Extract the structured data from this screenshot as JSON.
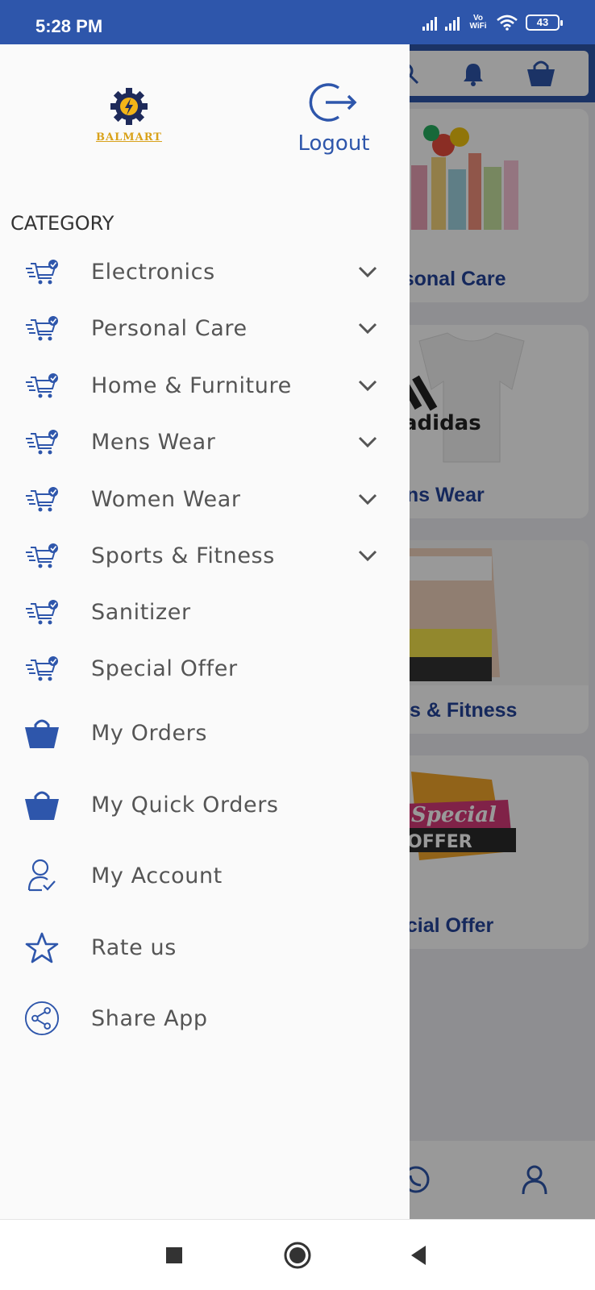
{
  "status_bar": {
    "time": "5:28 PM",
    "network_label": "Vo WiFi",
    "battery": "43"
  },
  "background": {
    "cards": [
      {
        "label": "rsonal Care"
      },
      {
        "label": "ens Wear"
      },
      {
        "label": "rts & Fitness"
      },
      {
        "label": "ecial Offer"
      }
    ],
    "promo_text": "Special",
    "promo_text2": "OFFER",
    "tshirt_brand": "adidas"
  },
  "drawer": {
    "logo_text": "BALMART",
    "logout_label": "Logout",
    "category_heading": "CATEGORY",
    "categories": [
      {
        "label": "Electronics",
        "expandable": true
      },
      {
        "label": "Personal Care",
        "expandable": true
      },
      {
        "label": "Home & Furniture",
        "expandable": true
      },
      {
        "label": "Mens Wear",
        "expandable": true
      },
      {
        "label": "Women Wear",
        "expandable": true
      },
      {
        "label": "Sports & Fitness",
        "expandable": true
      },
      {
        "label": "Sanitizer",
        "expandable": false
      },
      {
        "label": "Special Offer",
        "expandable": false
      }
    ],
    "links": [
      {
        "label": "My Orders",
        "icon": "shopping-bag-icon"
      },
      {
        "label": "My Quick Orders",
        "icon": "shopping-bag-icon"
      },
      {
        "label": "My Account",
        "icon": "user-check-icon"
      },
      {
        "label": "Rate us",
        "icon": "star-icon"
      },
      {
        "label": "Share App",
        "icon": "share-icon"
      }
    ]
  },
  "colors": {
    "brand_blue": "#2e56ab",
    "logo_gold": "#d9a21b"
  }
}
